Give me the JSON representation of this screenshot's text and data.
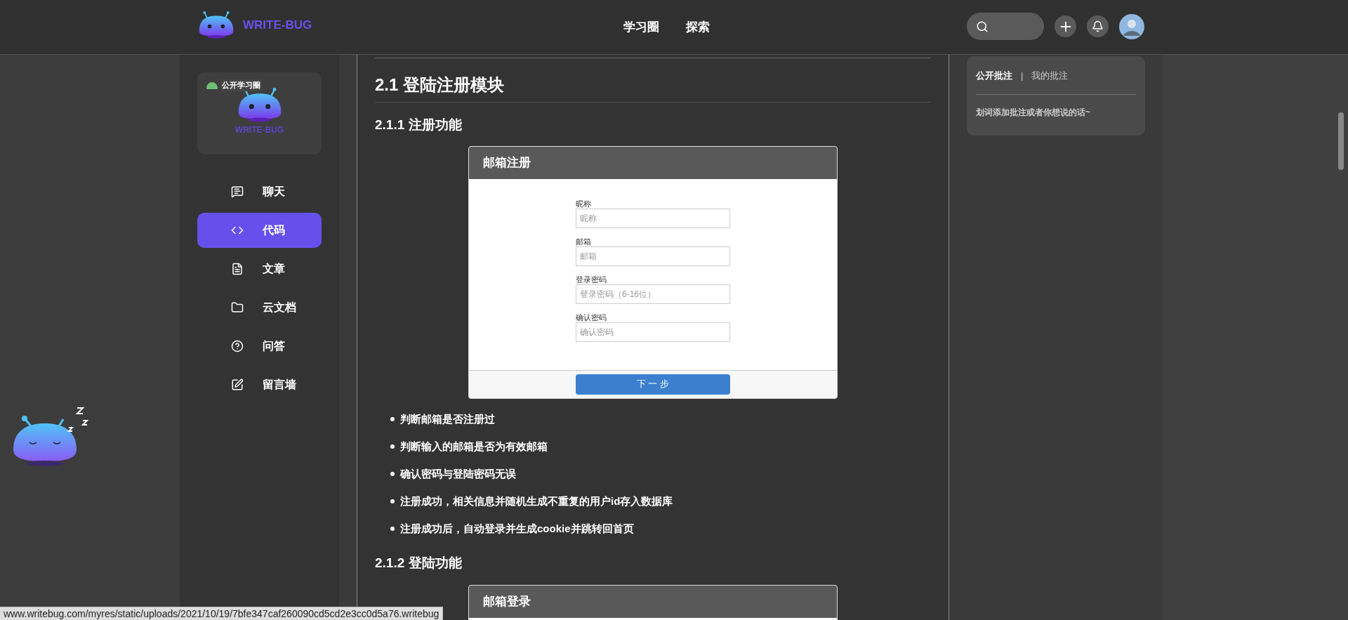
{
  "header": {
    "logo_text": "WRITE-BUG",
    "nav": [
      {
        "label": "学习圈"
      },
      {
        "label": "探索"
      }
    ]
  },
  "sidebar": {
    "circle_card": {
      "badge": "公开学习圈",
      "logo_text": "WRITE-BUG"
    },
    "items": [
      {
        "label": "聊天",
        "kind": "chat",
        "selected": false
      },
      {
        "label": "代码",
        "kind": "code",
        "selected": true
      },
      {
        "label": "文章",
        "kind": "article",
        "selected": false
      },
      {
        "label": "云文档",
        "kind": "folder",
        "selected": false
      },
      {
        "label": "问答",
        "kind": "question",
        "selected": false
      },
      {
        "label": "留言墙",
        "kind": "edit",
        "selected": false
      }
    ]
  },
  "article": {
    "heading": "2.1 登陆注册模块",
    "sections": [
      {
        "heading": "2.1.1 注册功能",
        "figure": {
          "title": "邮箱注册",
          "fields": [
            {
              "label": "昵称",
              "placeholder": "昵称"
            },
            {
              "label": "邮箱",
              "placeholder": "邮箱"
            },
            {
              "label": "登录密码",
              "placeholder": "登录密码（6-16位）"
            },
            {
              "label": "确认密码",
              "placeholder": "确认密码"
            }
          ],
          "button": "下 一 步"
        },
        "bullets": [
          "判断邮箱是否注册过",
          "判断输入的邮箱是否为有效邮箱",
          "确认密码与登陆密码无误",
          "注册成功，相关信息并随机生成不重复的用户id存入数据库",
          "注册成功后，自动登录并生成cookie并跳转回首页"
        ]
      },
      {
        "heading": "2.1.2 登陆功能",
        "figure": {
          "title": "邮箱登录"
        }
      }
    ]
  },
  "annotations": {
    "tabs": [
      {
        "label": "公开批注",
        "selected": true
      },
      {
        "label": "我的批注",
        "selected": false
      }
    ],
    "separator": "|",
    "hint": "划词添加批注或者你想说的话~"
  },
  "status_bar": {
    "url": "www.writebug.com/myres/static/uploads/2021/10/19/7bfe347caf260090cd5cd2e3cc0d5a76.writebug"
  }
}
